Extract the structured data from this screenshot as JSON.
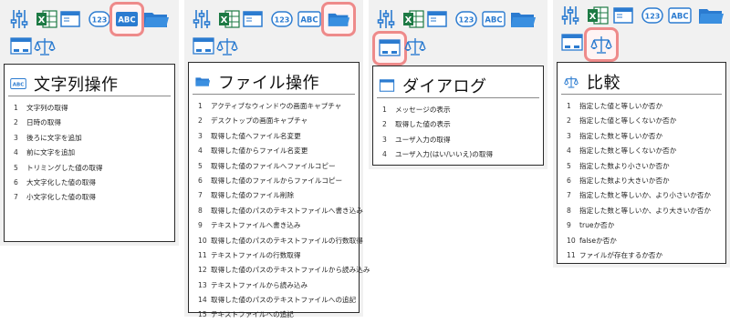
{
  "panels": [
    {
      "title": "文字列操作",
      "items": [
        "文字列の取得",
        "日時の取得",
        "後ろに文字を追加",
        "前に文字を追加",
        "トリミングした値の取得",
        "大文字化した値の取得",
        "小文字化した値の取得"
      ]
    },
    {
      "title": "ファイル操作",
      "items": [
        "アクティブなウィンドウの画面キャプチャ",
        "デスクトップの画面キャプチャ",
        "取得した値へファイル名変更",
        "取得した値からファイル名変更",
        "取得した値のファイルへファイルコピー",
        "取得した値のファイルからファイルコピー",
        "取得した値のファイル削除",
        "取得した値のパスのテキストファイルへ書き込み",
        "テキストファイルへ書き込み",
        "取得した値のパスのテキストファイルの行数取得",
        "テキストファイルの行数取得",
        "取得した値のパスのテキストファイルから読み込み",
        "テキストファイルから読み込み",
        "取得した値のパスのテキストファイルへの追記",
        "テキストファイルへの追記"
      ]
    },
    {
      "title": "ダイアログ",
      "items": [
        "メッセージの表示",
        "取得した値の表示",
        "ユーザ入力の取得",
        "ユーザ入力(はい/いいえ)の取得"
      ]
    },
    {
      "title": "比較",
      "items": [
        "指定した値と等しいか否か",
        "指定した値と等しくないか否か",
        "指定した数と等しいか否か",
        "指定した数と等しくないか否か",
        "指定した数より小さいか否か",
        "指定した数より大きいか否か",
        "指定した数と等しいか、より小さいか否か",
        "指定した数と等しいか、より大きいか否か",
        "trueか否か",
        "falseか否か",
        "ファイルが存在するか否か"
      ]
    }
  ],
  "icons": [
    "sliders-icon",
    "excel-icon",
    "window-icon",
    "number-123-icon",
    "abc-text-icon",
    "folder-icon",
    "dialog-window-icon",
    "scale-compare-icon"
  ],
  "colors": {
    "accent_blue": "#1e78c8",
    "excel_green": "#1d7a44",
    "highlight": "#ee8a8a"
  }
}
